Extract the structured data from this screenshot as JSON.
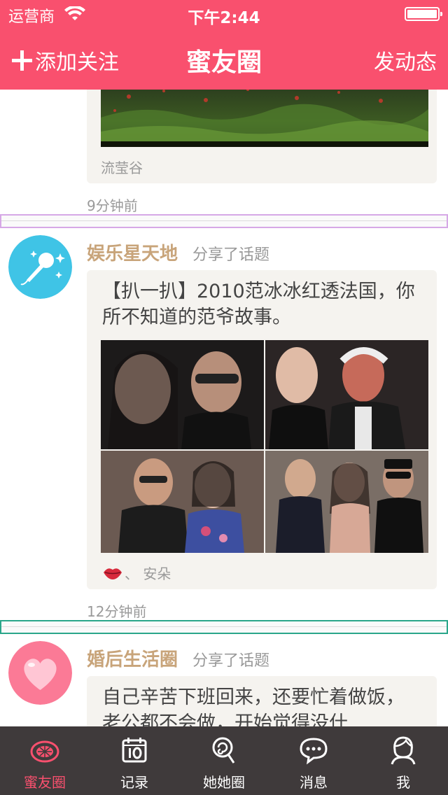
{
  "status_bar": {
    "carrier": "运营商",
    "time": "下午2:44"
  },
  "nav": {
    "left_label": "添加关注",
    "title": "蜜友圈",
    "right_label": "发动态"
  },
  "posts": [
    {
      "caption": "流莹谷",
      "time": "9分钟前"
    },
    {
      "author": "娱乐星天地",
      "action": "分享了话题",
      "text": "【扒一扒】2010范冰冰红透法国，你所不知道的范爷故事。",
      "liker": "、 安朵",
      "time": "12分钟前"
    },
    {
      "author": "婚后生活圈",
      "action": "分享了话题",
      "text": "自己辛苦下班回来，还要忙着做饭，老公都不会做，开始觉得没什"
    }
  ],
  "tabs": [
    {
      "label": "蜜友圈",
      "icon": "grapefruit-icon",
      "active": true
    },
    {
      "label": "记录",
      "icon": "calendar-icon",
      "active": false
    },
    {
      "label": "她她圈",
      "icon": "lollipop-icon",
      "active": false
    },
    {
      "label": "消息",
      "icon": "chat-bubble-icon",
      "active": false
    },
    {
      "label": "我",
      "icon": "profile-icon",
      "active": false
    }
  ],
  "colors": {
    "accent": "#f9506e",
    "author": "#c8a47a",
    "tabbar": "#3f3a3b"
  }
}
